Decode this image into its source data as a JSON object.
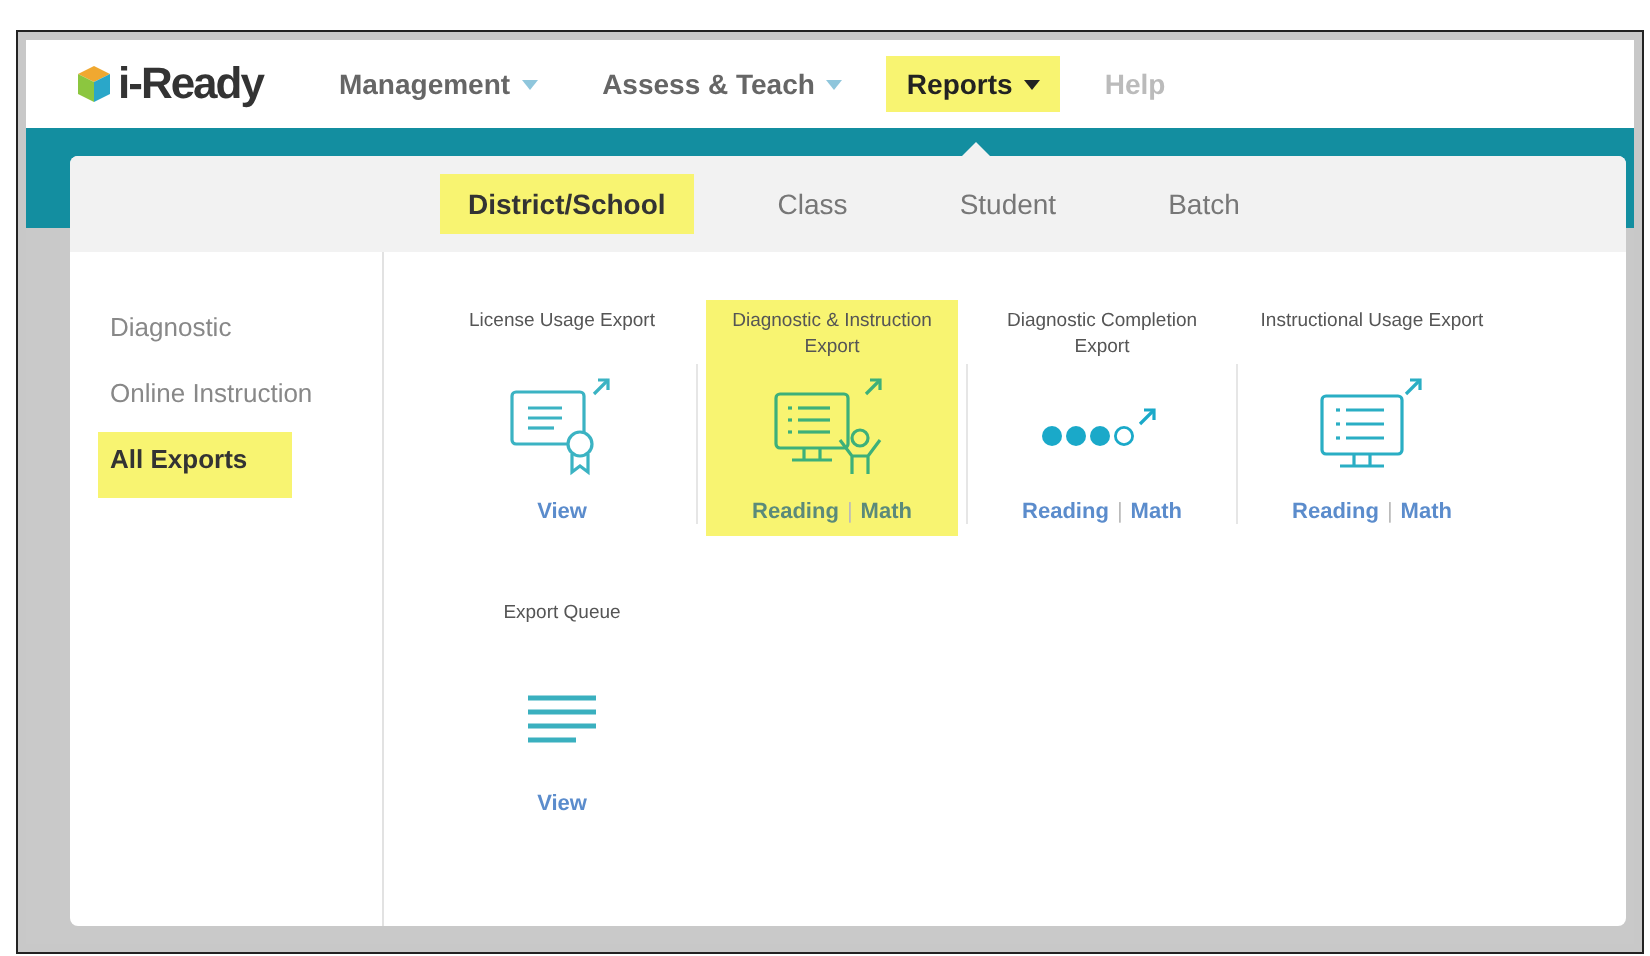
{
  "logo": {
    "text": "i-Ready"
  },
  "nav": [
    {
      "label": "Management",
      "has_menu": true,
      "highlighted": false,
      "disabled": false
    },
    {
      "label": "Assess & Teach",
      "has_menu": true,
      "highlighted": false,
      "disabled": false
    },
    {
      "label": "Reports",
      "has_menu": true,
      "highlighted": true,
      "disabled": false
    },
    {
      "label": "Help",
      "has_menu": false,
      "highlighted": false,
      "disabled": true
    }
  ],
  "tabs": [
    {
      "label": "District/School",
      "selected": true
    },
    {
      "label": "Class",
      "selected": false
    },
    {
      "label": "Student",
      "selected": false
    },
    {
      "label": "Batch",
      "selected": false
    }
  ],
  "sidebar": {
    "items": [
      {
        "label": "Diagnostic",
        "selected": false
      },
      {
        "label": "Online Instruction",
        "selected": false
      },
      {
        "label": "All Exports",
        "selected": true
      }
    ]
  },
  "link_separator": "|",
  "exports": [
    {
      "title": "License Usage Export",
      "kind": "certificate",
      "highlighted": false,
      "links": [
        "View"
      ]
    },
    {
      "title": "Diagnostic & Instruction Export",
      "kind": "monitor-person",
      "highlighted": true,
      "links": [
        "Reading",
        "Math"
      ]
    },
    {
      "title": "Diagnostic Completion Export",
      "kind": "dots",
      "highlighted": false,
      "links": [
        "Reading",
        "Math"
      ]
    },
    {
      "title": "Instructional Usage Export",
      "kind": "monitor",
      "highlighted": false,
      "links": [
        "Reading",
        "Math"
      ]
    },
    {
      "title": "Export Queue",
      "kind": "lines",
      "highlighted": false,
      "links": [
        "View"
      ]
    }
  ]
}
